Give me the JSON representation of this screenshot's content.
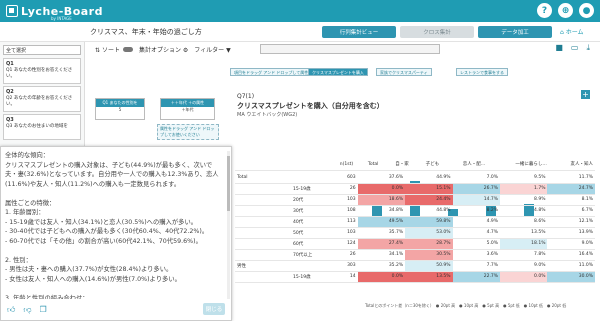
{
  "app": {
    "logo": "Lyche-Board",
    "logo_sub": "by INTAGE"
  },
  "header": {
    "crumb": "クリスマス、年末・年始の過ごし方",
    "tab_active": "行列集計ビュー",
    "tab_cross": "クロス集計",
    "tab_data": "データ加工",
    "home": "ホーム"
  },
  "toolbar": {
    "sort": "ソート",
    "options": "集計オプション",
    "filter": "フィルター"
  },
  "left": {
    "search": "全て選択",
    "items": [
      {
        "id": "Q1",
        "text": "Q1 あなたの性別をお答えください。"
      },
      {
        "id": "Q2",
        "text": "Q2 あなたの年齢をお答えください。"
      },
      {
        "id": "Q3",
        "text": "Q3 あなたのお住まいの地域を"
      }
    ]
  },
  "canvas": {
    "node1_title": "Q1 あなたの性別を",
    "node1_val": "5",
    "node2_title": "＋＋年代 ＋の属性",
    "node2_val": "＋年代",
    "drop": "属性をドラッグ アンド ドロップしてお使いください"
  },
  "flow": {
    "chip1": "項目をドラッグ アンド ドロップして属性に追加",
    "chip2": "クリスマスプレゼントを購入",
    "chip3": "家族でクリスマスパーティ",
    "chip4": "レストランで食事をする"
  },
  "question": {
    "id": "Q7(1)",
    "title": "クリスマスプレゼントを購入（自分用を含む）",
    "meta": "MA ウエイトバック(WG2)"
  },
  "table": {
    "header": [
      "n(1st)",
      "Total",
      "自・家",
      "子ども",
      "恋人・配…",
      "一緒に暮らし…",
      "友人・知人"
    ],
    "rows": [
      [
        "Total",
        "",
        "603",
        "37.6%",
        "44.9%",
        "7.0%",
        "9.5%",
        "11.7%"
      ],
      [
        "",
        "15-19歳",
        "26",
        "0.0%",
        "15.1%",
        "26.7%",
        "1.7%",
        "24.7%"
      ],
      [
        "",
        "20代",
        "103",
        "18.6%",
        "24.4%",
        "14.7%",
        "8.9%",
        "8.1%"
      ],
      [
        "",
        "30代",
        "108",
        "34.8%",
        "44.8%",
        "8.2%",
        "4.8%",
        "6.7%"
      ],
      [
        "",
        "40代",
        "113",
        "49.5%",
        "59.8%",
        "4.9%",
        "8.6%",
        "12.1%"
      ],
      [
        "",
        "50代",
        "103",
        "35.7%",
        "53.0%",
        "4.7%",
        "13.5%",
        "13.9%"
      ],
      [
        "",
        "60代",
        "124",
        "27.4%",
        "28.7%",
        "5.0%",
        "18.1%",
        "9.0%"
      ],
      [
        "",
        "70代以上",
        "26",
        "34.1%",
        "30.5%",
        "3.6%",
        "7.8%",
        "16.4%"
      ],
      [
        "男性",
        "",
        "303",
        "35.2%",
        "50.9%",
        "7.7%",
        "9.0%",
        "11.0%"
      ],
      [
        "",
        "15-19歳",
        "14",
        "0.0%",
        "13.5%",
        "22.7%",
        "0.0%",
        "30.0%"
      ]
    ]
  },
  "legend": "Totalとのポイント差（n＝30を除く）　● 20pt 高　● 10pt 高　● 5pt 高　● 5pt 低　● 10pt 低　● 20pt 低",
  "popup": {
    "lines": [
      "全体的な傾向：",
      "クリスマスプレゼントの購入対象は、子ども(44.9%)が最も多く、次いで",
      "夫・妻(32.6%)となっています。自分用や一人での購入も12.3%あり、恋人",
      "(11.6%)や友人・知人(11.2%)への購入も一定数見られます。",
      "",
      "属性ごとの特徴：",
      "1. 年齢層別：",
      "- 15-19歳では友人・知人(34.1%)と恋人(30.5%)への購入が多い。",
      "- 30-40代では子どもへの購入が最も多く(30代60.4%、40代72.2%)。",
      "- 60-70代では「その他」の割合が高い(60代42.1%、70代59.6%)。",
      "",
      "2. 性別：",
      "- 男性は夫・妻への購入(37.7%)が女性(28.4%)より多い。",
      "- 女性は友人・知人への購入(14.6%)が男性(7.0%)より多い。",
      "",
      "3. 年齢と性別の組み合わせ："
    ],
    "close": "閉じる"
  }
}
